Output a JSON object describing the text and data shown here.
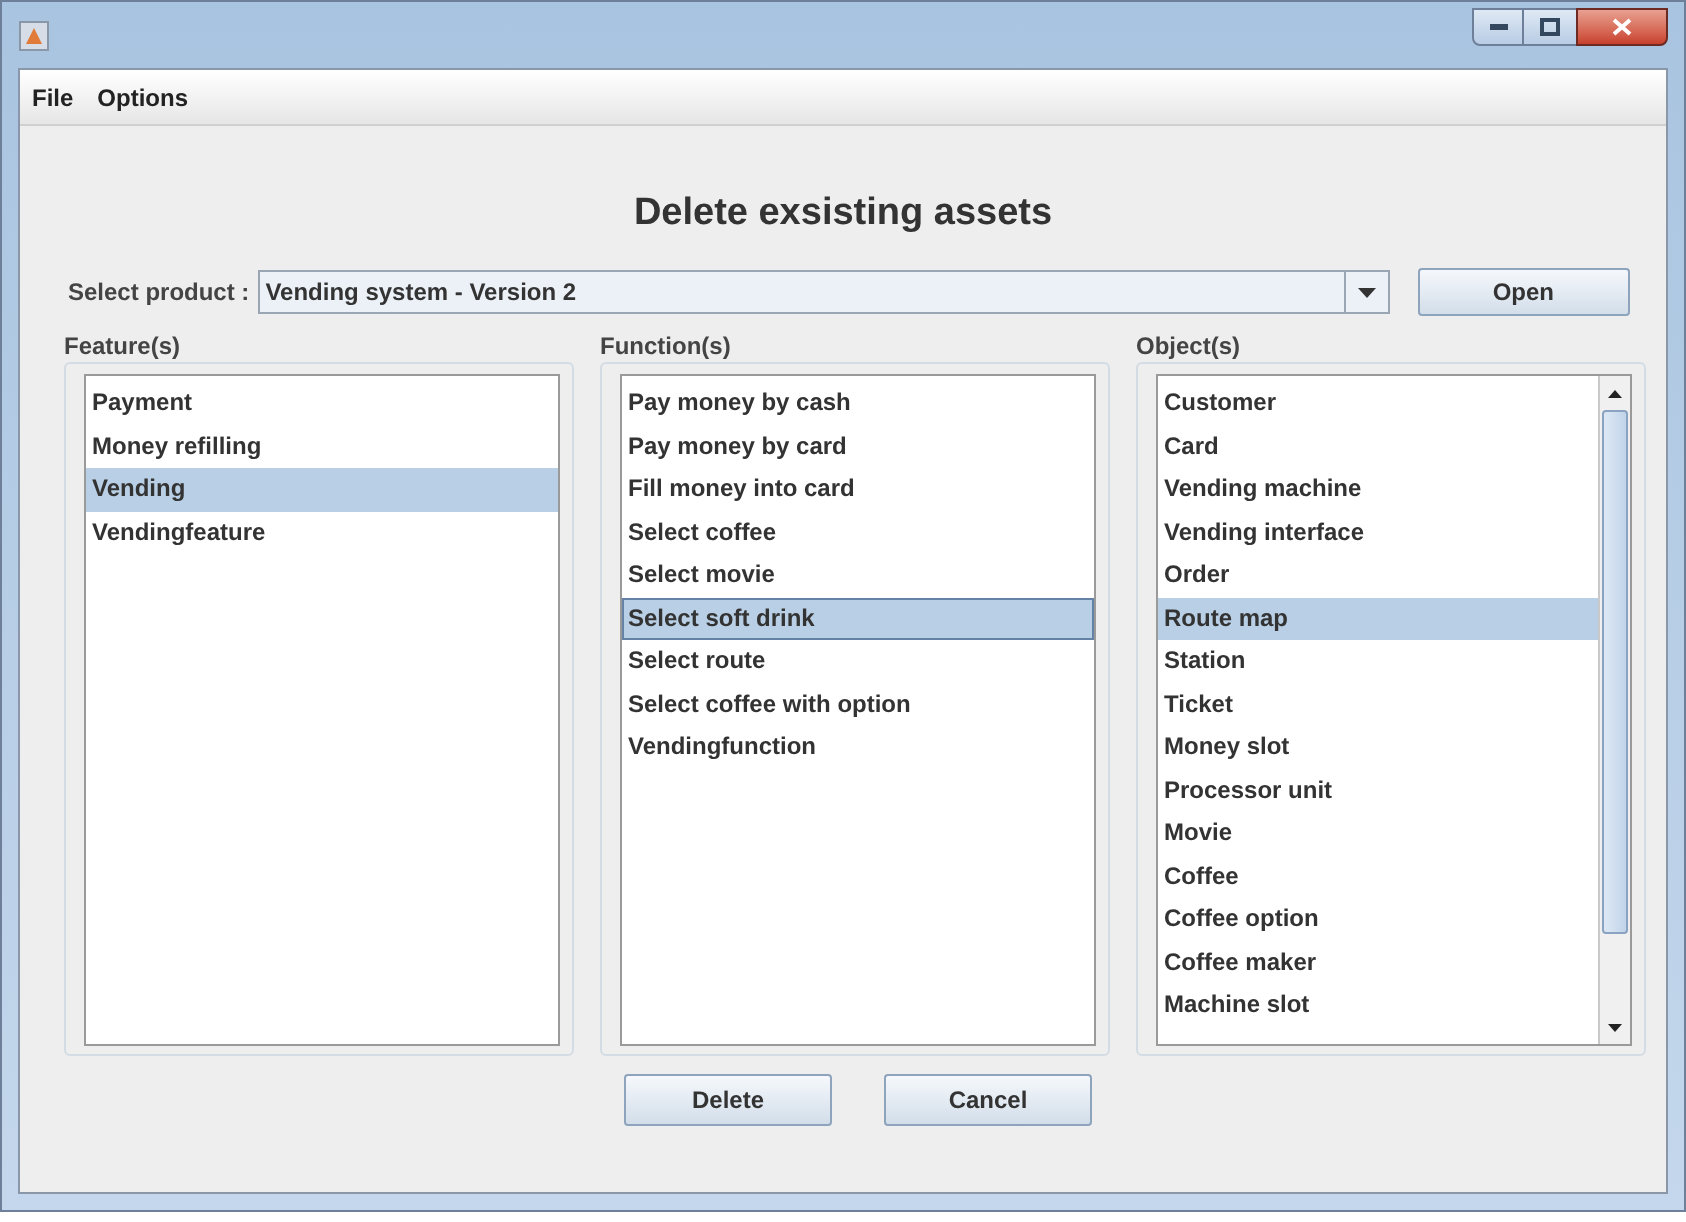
{
  "menu": [
    "File",
    "Options"
  ],
  "heading": "Delete exsisting assets",
  "product": {
    "label": "Select product :",
    "value": "Vending system - Version 2",
    "button": "Open"
  },
  "lists": [
    {
      "title": "Feature(s)",
      "focused": false,
      "scrollbar": false,
      "items": [
        {
          "label": "Payment",
          "selected": false
        },
        {
          "label": "Money refilling",
          "selected": false
        },
        {
          "label": "Vending",
          "selected": true
        },
        {
          "label": "Vendingfeature",
          "selected": false
        }
      ]
    },
    {
      "title": "Function(s)",
      "focused": true,
      "scrollbar": false,
      "items": [
        {
          "label": "Pay money by cash",
          "selected": false
        },
        {
          "label": "Pay money by card",
          "selected": false
        },
        {
          "label": "Fill money into card",
          "selected": false
        },
        {
          "label": "Select coffee",
          "selected": false
        },
        {
          "label": "Select movie",
          "selected": false
        },
        {
          "label": "Select soft drink",
          "selected": true
        },
        {
          "label": "Select route",
          "selected": false
        },
        {
          "label": "Select coffee with option",
          "selected": false
        },
        {
          "label": "Vendingfunction",
          "selected": false
        }
      ]
    },
    {
      "title": "Object(s)",
      "focused": false,
      "scrollbar": true,
      "items": [
        {
          "label": "Customer",
          "selected": false
        },
        {
          "label": "Card",
          "selected": false
        },
        {
          "label": "Vending machine",
          "selected": false
        },
        {
          "label": "Vending interface",
          "selected": false
        },
        {
          "label": "Order",
          "selected": false
        },
        {
          "label": "Route map",
          "selected": true
        },
        {
          "label": "Station",
          "selected": false
        },
        {
          "label": "Ticket",
          "selected": false
        },
        {
          "label": "Money slot",
          "selected": false
        },
        {
          "label": "Processor unit",
          "selected": false
        },
        {
          "label": "Movie",
          "selected": false
        },
        {
          "label": "Coffee",
          "selected": false
        },
        {
          "label": "Coffee option",
          "selected": false
        },
        {
          "label": "Coffee maker",
          "selected": false
        },
        {
          "label": "Machine slot",
          "selected": false
        }
      ]
    }
  ],
  "buttons": [
    "Delete",
    "Cancel"
  ]
}
